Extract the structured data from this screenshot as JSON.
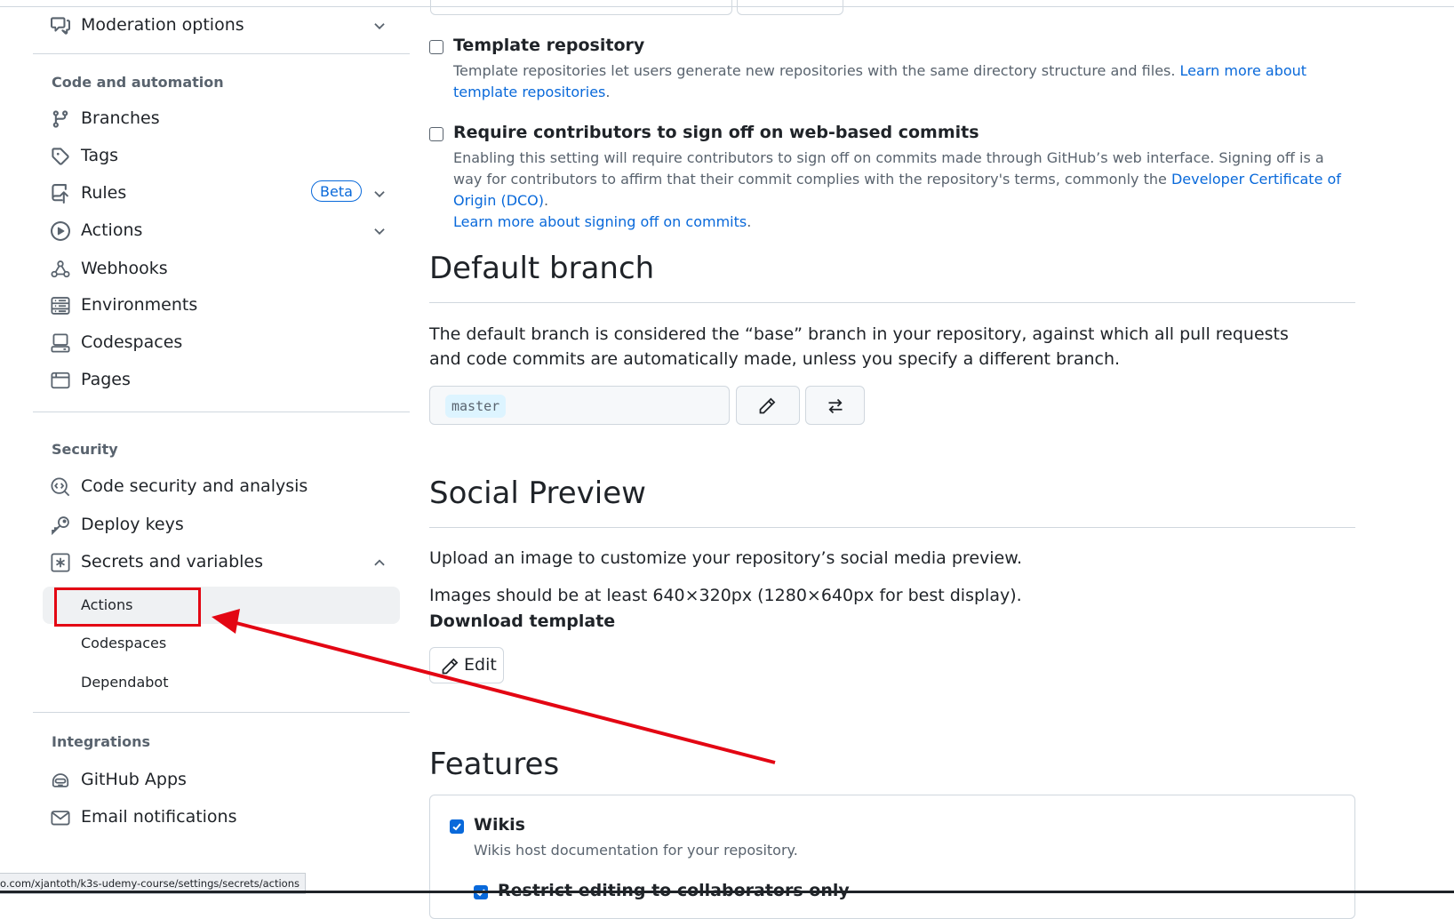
{
  "sidebar": {
    "moderation": {
      "label": "Moderation options",
      "icon": "comment-discussion-icon"
    },
    "code_automation": {
      "heading": "Code and automation",
      "items": [
        {
          "label": "Branches",
          "icon": "git-branch-icon"
        },
        {
          "label": "Tags",
          "icon": "tag-icon"
        },
        {
          "label": "Rules",
          "icon": "repo-push-icon",
          "badge": "Beta"
        },
        {
          "label": "Actions",
          "icon": "play-icon"
        },
        {
          "label": "Webhooks",
          "icon": "webhook-icon"
        },
        {
          "label": "Environments",
          "icon": "server-icon"
        },
        {
          "label": "Codespaces",
          "icon": "codespaces-icon"
        },
        {
          "label": "Pages",
          "icon": "browser-icon"
        }
      ]
    },
    "security": {
      "heading": "Security",
      "items": [
        {
          "label": "Code security and analysis",
          "icon": "codescan-icon"
        },
        {
          "label": "Deploy keys",
          "icon": "key-icon"
        },
        {
          "label": "Secrets and variables",
          "icon": "key-asterisk-icon"
        }
      ],
      "sub_items": [
        "Actions",
        "Codespaces",
        "Dependabot"
      ]
    },
    "integrations": {
      "heading": "Integrations",
      "items": [
        {
          "label": "GitHub Apps",
          "icon": "hubot-icon"
        },
        {
          "label": "Email notifications",
          "icon": "mail-icon"
        }
      ]
    }
  },
  "status_url": "o.com/xjantoth/k3s-udemy-course/settings/secrets/actions",
  "main": {
    "template_repo": {
      "title": "Template repository",
      "desc": "Template repositories let users generate new repositories with the same directory structure and files. ",
      "link": "Learn more about template repositories",
      "checked": false
    },
    "signoff": {
      "title": "Require contributors to sign off on web-based commits",
      "desc": "Enabling this setting will require contributors to sign off on commits made through GitHub’s web interface. Signing off is a way for contributors to affirm that their commit complies with the repository's terms, commonly the ",
      "link1": "Developer Certificate of Origin (DCO)",
      "link2": "Learn more about signing off on commits",
      "checked": false
    },
    "default_branch": {
      "heading": "Default branch",
      "desc": "The default branch is considered the “base” branch in your repository, against which all pull requests and code commits are automatically made, unless you specify a different branch.",
      "branch": "master"
    },
    "social_preview": {
      "heading": "Social Preview",
      "desc1": "Upload an image to customize your repository’s social media preview.",
      "desc2": "Images should be at least 640×320px (1280×640px for best display).",
      "download": "Download template",
      "edit": "Edit"
    },
    "features": {
      "heading": "Features",
      "wikis": {
        "title": "Wikis",
        "desc": "Wikis host documentation for your repository.",
        "checked": true
      },
      "restrict": {
        "title": "Restrict editing to collaborators only",
        "checked": true
      }
    }
  },
  "colors": {
    "link": "#0969da",
    "annotation": "#e30613",
    "checkbox": "#0969da"
  }
}
